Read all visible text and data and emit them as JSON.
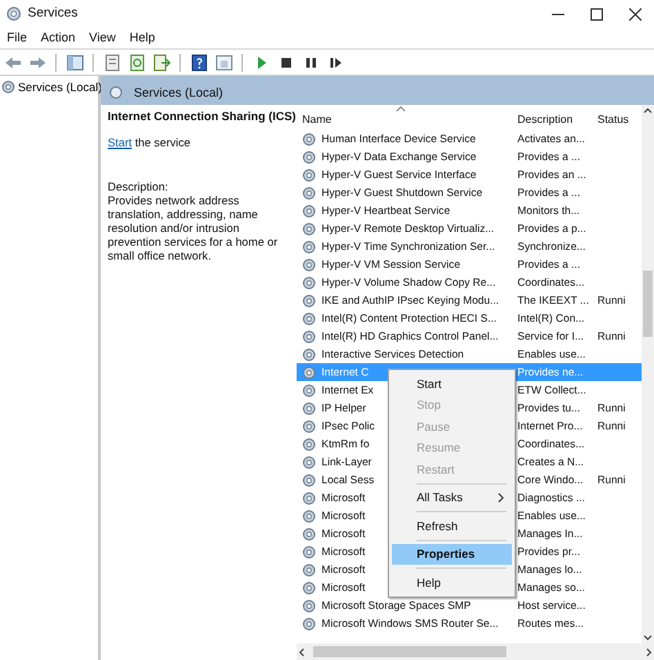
{
  "window": {
    "title": "Services"
  },
  "menu": [
    "File",
    "Action",
    "View",
    "Help"
  ],
  "tree": [
    {
      "label": "Services (Local)",
      "selected": false
    }
  ],
  "panel": {
    "title": "Services (Local)"
  },
  "details": {
    "title": "Internet Connection Sharing (ICS)",
    "action_link": "Start",
    "action_text": "the service",
    "description_label": "Description:",
    "description": "Provides network address translation, addressing, name resolution and/or intrusion prevention services for a home or small office network."
  },
  "table": {
    "columns": [
      "Name",
      "Description",
      "Status"
    ],
    "rows": [
      {
        "name": "Human Interface Device Service",
        "description": "Activates an...",
        "status": "",
        "selected": false
      },
      {
        "name": "Hyper-V Data Exchange Service",
        "description": "Provides a ...",
        "status": "",
        "selected": false
      },
      {
        "name": "Hyper-V Guest Service Interface",
        "description": "Provides an ...",
        "status": "",
        "selected": false
      },
      {
        "name": "Hyper-V Guest Shutdown Service",
        "description": "Provides a ...",
        "status": "",
        "selected": false
      },
      {
        "name": "Hyper-V Heartbeat Service",
        "description": "Monitors th...",
        "status": "",
        "selected": false
      },
      {
        "name": "Hyper-V Remote Desktop Virtualiz...",
        "description": "Provides a p...",
        "status": "",
        "selected": false
      },
      {
        "name": "Hyper-V Time Synchronization Ser...",
        "description": "Synchronize...",
        "status": "",
        "selected": false
      },
      {
        "name": "Hyper-V VM Session Service",
        "description": "Provides a ...",
        "status": "",
        "selected": false
      },
      {
        "name": "Hyper-V Volume Shadow Copy Re...",
        "description": "Coordinates...",
        "status": "",
        "selected": false
      },
      {
        "name": "IKE and AuthIP IPsec Keying Modu...",
        "description": "The IKEEXT ...",
        "status": "Runni",
        "selected": false
      },
      {
        "name": "Intel(R) Content Protection HECI S...",
        "description": "Intel(R) Con...",
        "status": "",
        "selected": false
      },
      {
        "name": "Intel(R) HD Graphics Control Panel...",
        "description": "Service for I...",
        "status": "Runni",
        "selected": false
      },
      {
        "name": "Interactive Services Detection",
        "description": "Enables use...",
        "status": "",
        "selected": false
      },
      {
        "name": "Internet C",
        "description": "Provides ne...",
        "status": "",
        "selected": true
      },
      {
        "name": "Internet Ex",
        "description": "ETW Collect...",
        "status": "",
        "selected": false
      },
      {
        "name": "IP Helper",
        "description": "Provides tu...",
        "status": "Runni",
        "selected": false
      },
      {
        "name": "IPsec Polic",
        "description": "Internet Pro...",
        "status": "Runni",
        "selected": false
      },
      {
        "name": "KtmRm fo",
        "description": "Coordinates...",
        "status": "",
        "selected": false
      },
      {
        "name": "Link-Layer",
        "description": "Creates a N...",
        "status": "",
        "selected": false
      },
      {
        "name": "Local Sess",
        "description": "Core Windo...",
        "status": "Runni",
        "selected": false
      },
      {
        "name": "Microsoft",
        "description": "Diagnostics ...",
        "status": "",
        "selected": false
      },
      {
        "name": "Microsoft",
        "description": "Enables use...",
        "status": "",
        "selected": false
      },
      {
        "name": "Microsoft",
        "description": "Manages In...",
        "status": "",
        "selected": false
      },
      {
        "name": "Microsoft",
        "description": "Provides pr...",
        "status": "",
        "selected": false
      },
      {
        "name": "Microsoft",
        "description": "Manages lo...",
        "status": "",
        "selected": false
      },
      {
        "name": "Microsoft",
        "description": "Manages so...",
        "status": "",
        "selected": false
      },
      {
        "name": "Microsoft Storage Spaces SMP",
        "description": "Host service...",
        "status": "",
        "selected": false
      },
      {
        "name": "Microsoft Windows SMS Router Se...",
        "description": "Routes mes...",
        "status": "",
        "selected": false
      }
    ]
  },
  "context_menu": [
    {
      "kind": "item",
      "label": "Start",
      "disabled": false,
      "selected": false
    },
    {
      "kind": "item",
      "label": "Stop",
      "disabled": true,
      "selected": false
    },
    {
      "kind": "item",
      "label": "Pause",
      "disabled": true,
      "selected": false
    },
    {
      "kind": "item",
      "label": "Resume",
      "disabled": true,
      "selected": false
    },
    {
      "kind": "item",
      "label": "Restart",
      "disabled": true,
      "selected": false
    },
    {
      "kind": "separator"
    },
    {
      "kind": "submenu",
      "label": "All Tasks",
      "disabled": false,
      "selected": false
    },
    {
      "kind": "separator"
    },
    {
      "kind": "item",
      "label": "Refresh",
      "disabled": false,
      "selected": false
    },
    {
      "kind": "separator"
    },
    {
      "kind": "default",
      "label": "Properties",
      "disabled": false,
      "selected": true
    },
    {
      "kind": "separator"
    },
    {
      "kind": "item",
      "label": "Help",
      "disabled": false,
      "selected": false
    }
  ]
}
